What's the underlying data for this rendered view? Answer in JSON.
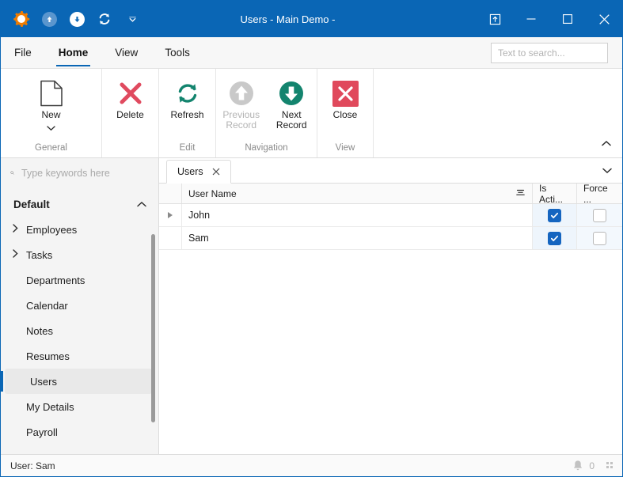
{
  "window": {
    "title": "Users - Main Demo -",
    "app_icon": "sun-icon",
    "quick_access": [
      {
        "name": "app-menu-icon",
        "icon": "sun-icon",
        "label": ""
      },
      {
        "name": "previous-record-qat",
        "icon": "arrow-up-circle-icon",
        "label": ""
      },
      {
        "name": "next-record-qat",
        "icon": "arrow-down-circle-icon",
        "label": ""
      },
      {
        "name": "refresh-qat",
        "icon": "refresh-icon",
        "label": ""
      },
      {
        "name": "qat-overflow",
        "icon": "chevron-down-icon",
        "label": ""
      }
    ],
    "controls": {
      "restore_down_label": "restore-window-icon",
      "minimize_label": "minimize-icon",
      "maximize_label": "maximize-icon",
      "close_label": "close-icon"
    },
    "accent_color": "#0a66b5"
  },
  "menu": {
    "tabs": [
      {
        "label": "File",
        "active": false
      },
      {
        "label": "Home",
        "active": true
      },
      {
        "label": "View",
        "active": false
      },
      {
        "label": "Tools",
        "active": false
      }
    ]
  },
  "search": {
    "placeholder": "Text to search...",
    "value": "",
    "icon": "search-icon"
  },
  "ribbon": {
    "collapse_icon": "chevron-up-icon",
    "groups": [
      {
        "label": "General",
        "buttons": [
          {
            "label": "New",
            "icon": "new-document-icon",
            "disabled": false,
            "has_dropdown": true
          }
        ]
      },
      {
        "label": "Edit",
        "buttons": [
          {
            "label": "Delete",
            "icon": "delete-x-icon",
            "disabled": false,
            "has_dropdown": false
          },
          {
            "label": "Refresh",
            "icon": "refresh-icon",
            "disabled": false,
            "has_dropdown": false
          }
        ]
      },
      {
        "label": "Navigation",
        "buttons": [
          {
            "label": "Previous\nRecord",
            "label_line1": "Previous",
            "label_line2": "Record",
            "icon": "arrow-up-circle-icon",
            "disabled": true,
            "has_dropdown": false
          },
          {
            "label": "Next\nRecord",
            "label_line1": "Next",
            "label_line2": "Record",
            "icon": "arrow-down-circle-icon",
            "disabled": false,
            "has_dropdown": false
          }
        ]
      },
      {
        "label": "View",
        "buttons": [
          {
            "label": "Close",
            "icon": "close-square-icon",
            "disabled": false,
            "has_dropdown": false
          }
        ]
      }
    ],
    "colors": {
      "delete": "#e04a5f",
      "refresh": "#13846e",
      "next": "#13846e",
      "previous_disabled": "#c9c9c9",
      "close": "#e0495c"
    }
  },
  "sidebar": {
    "search_placeholder": "Type keywords here",
    "search_value": "",
    "search_icon": "search-icon",
    "group": {
      "label": "Default",
      "collapse_icon": "chevron-up-icon"
    },
    "items": [
      {
        "label": "Employees",
        "expandable": true,
        "selected": false
      },
      {
        "label": "Tasks",
        "expandable": true,
        "selected": false
      },
      {
        "label": "Departments",
        "expandable": false,
        "selected": false
      },
      {
        "label": "Calendar",
        "expandable": false,
        "selected": false
      },
      {
        "label": "Notes",
        "expandable": false,
        "selected": false
      },
      {
        "label": "Resumes",
        "expandable": false,
        "selected": false
      },
      {
        "label": "Users",
        "expandable": false,
        "selected": true
      },
      {
        "label": "My Details",
        "expandable": false,
        "selected": false
      },
      {
        "label": "Payroll",
        "expandable": false,
        "selected": false
      }
    ]
  },
  "document_tabs": {
    "tabs": [
      {
        "label": "Users",
        "active": true,
        "close_icon": "close-icon"
      }
    ],
    "overflow_icon": "chevron-down-icon"
  },
  "grid": {
    "columns": [
      {
        "key": "indicator",
        "label": ""
      },
      {
        "key": "name",
        "label": "User Name",
        "filter_icon": "filter-icon"
      },
      {
        "key": "isactive",
        "label": "Is Acti..."
      },
      {
        "key": "force",
        "label": "Force ..."
      }
    ],
    "rows": [
      {
        "indicator": true,
        "name": "John",
        "isactive": true,
        "force": false
      },
      {
        "indicator": false,
        "name": "Sam",
        "isactive": true,
        "force": false
      }
    ]
  },
  "statusbar": {
    "user_label": "User: Sam",
    "notification_icon": "bell-icon",
    "notification_count": "0",
    "grip_icon": "resize-grip-icon"
  }
}
